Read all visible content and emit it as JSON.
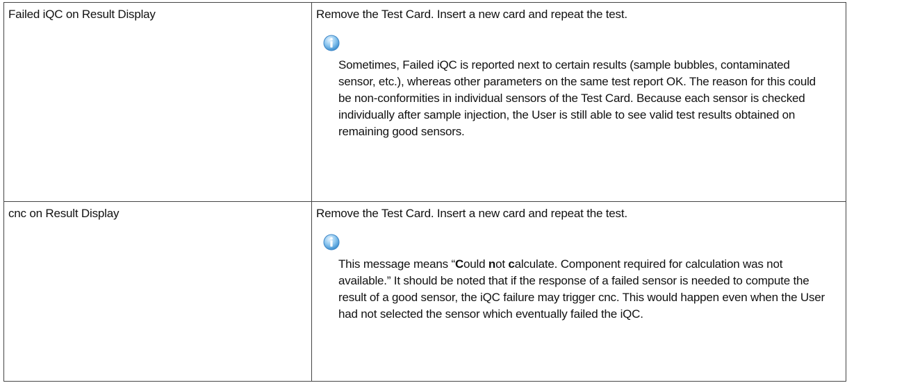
{
  "rows": [
    {
      "condition": "Failed iQC on Result Display",
      "action": "Remove the Test Card. Insert a new card and repeat the test.",
      "note_icon": "info-icon",
      "note": "Sometimes, Failed iQC is reported next to certain results (sample bubbles, contaminated sensor, etc.), whereas other parameters on the same test report OK.  The reason for this could be non-conformities in individual sensors of the Test Card.  Because each sensor is checked individually after sample injection, the User is still able to see valid test results obtained on remaining good sensors."
    },
    {
      "condition": "cnc on Result Display",
      "action": "Remove the Test Card. Insert a new card and repeat the test.",
      "note_icon": "info-icon",
      "note_parts": {
        "open_quote": "This message means “",
        "c1": "C",
        "t1": "ould ",
        "n1": "n",
        "t2": "ot ",
        "c2": "c",
        "rest": "alculate.  Component required for calculation was not available.”  It should be noted that if the response of a failed sensor is needed to compute the result of a good sensor, the iQC failure may trigger cnc.  This would happen even when the User had not selected the sensor which eventually failed the iQC."
      }
    }
  ]
}
